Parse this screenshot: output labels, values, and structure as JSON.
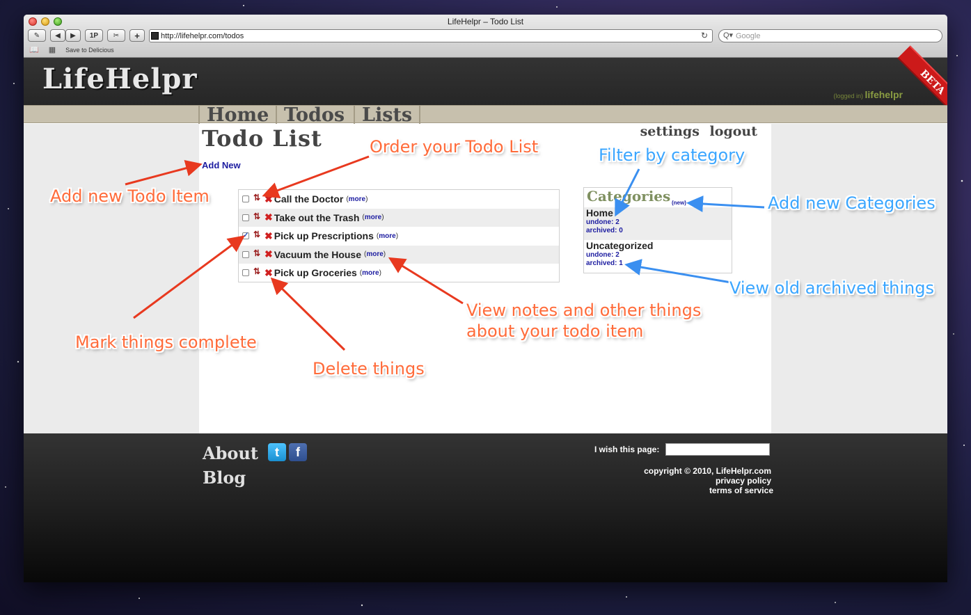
{
  "browser": {
    "window_title": "LifeHelpr – Todo List",
    "url": "http://lifehelpr.com/todos",
    "search_placeholder": "Google",
    "bookmark": "Save to Delicious",
    "btn_1p": "1P",
    "btn_plus": "+"
  },
  "site": {
    "logo": "LifeHelpr",
    "logged_in_label": "(logged in)",
    "username": "lifehelpr",
    "beta": "BETA",
    "nav": [
      "Home",
      "Todos",
      "Lists"
    ],
    "page_title": "Todo List",
    "settings": "settings",
    "logout": "logout",
    "add_new": "Add New"
  },
  "todos": [
    {
      "text": "Call the Doctor",
      "checked": false,
      "more": "more"
    },
    {
      "text": "Take out the Trash",
      "checked": false,
      "more": "more"
    },
    {
      "text": "Pick up Prescriptions",
      "checked": true,
      "more": "more"
    },
    {
      "text": "Vacuum the House",
      "checked": false,
      "more": "more"
    },
    {
      "text": "Pick up Groceries",
      "checked": false,
      "more": "more"
    }
  ],
  "categories": {
    "title": "Categories",
    "new_label": "(new)",
    "items": [
      {
        "name": "Home",
        "undone": "undone: 2",
        "archived": "archived: 0"
      },
      {
        "name": "Uncategorized",
        "undone": "undone: 2",
        "archived": "archived: 1"
      }
    ]
  },
  "footer": {
    "about": "About",
    "blog": "Blog",
    "wish_label": "I wish this page:",
    "copyright": "copyright © 2010, LifeHelpr.com",
    "privacy": "privacy policy",
    "terms": "terms of service"
  },
  "annotations": {
    "add_item": "Add new Todo Item",
    "order": "Order your Todo List",
    "filter": "Filter by category",
    "add_categories": "Add new Categories",
    "view_archived": "View old archived things",
    "view_notes_1": "View notes and other things",
    "view_notes_2": "about your todo item",
    "mark_complete": "Mark things complete",
    "delete": "Delete things"
  },
  "colors": {
    "annotation_orange": "#ff6b3a",
    "annotation_blue": "#3ba6ff",
    "arrow_red": "#e8391f",
    "link_blue": "#1c1ca0",
    "nav_bar": "#c7c0ad"
  }
}
